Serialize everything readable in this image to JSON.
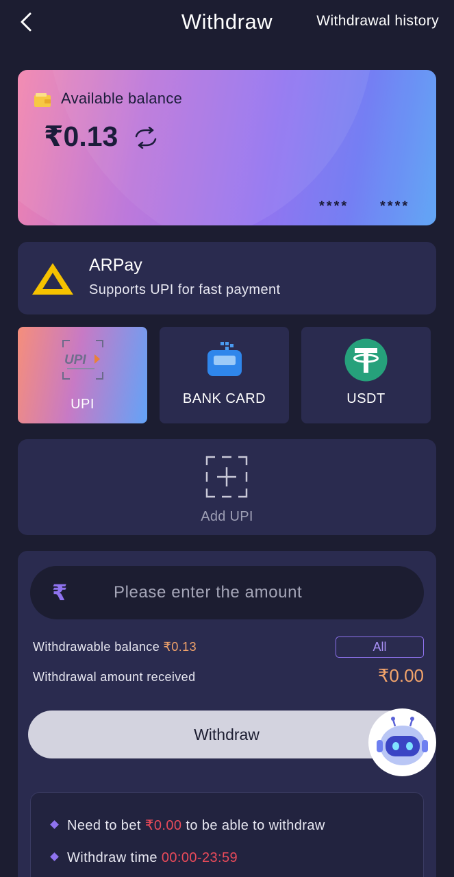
{
  "header": {
    "title": "Withdraw",
    "history_link": "Withdrawal history"
  },
  "balance_card": {
    "label": "Available balance",
    "value": "₹0.13",
    "masked_left": "****",
    "masked_right": "****"
  },
  "channel": {
    "name": "ARPay",
    "description": "Supports UPI for fast payment"
  },
  "methods": [
    {
      "label": "UPI",
      "icon": "upi-icon",
      "active": true
    },
    {
      "label": "BANK CARD",
      "icon": "bank-card-icon",
      "active": false
    },
    {
      "label": "USDT",
      "icon": "usdt-icon",
      "active": false
    }
  ],
  "add_upi": {
    "label": "Add UPI"
  },
  "form": {
    "currency_symbol": "₹",
    "amount_placeholder": "Please enter the amount",
    "withdrawable_label": "Withdrawable balance ",
    "withdrawable_value": "₹0.13",
    "all_button": "All",
    "received_label": "Withdrawal amount received",
    "received_value": "₹0.00",
    "withdraw_button": "Withdraw"
  },
  "notes": [
    {
      "before": "Need to bet ",
      "highlight": "₹0.00",
      "after": " to be able to withdraw"
    },
    {
      "before": "Withdraw time ",
      "highlight": "00:00-23:59",
      "after": ""
    }
  ],
  "colors": {
    "background": "#1c1d31",
    "panel": "#2a2b4f",
    "accent": "#8f73ef",
    "highlight_orange": "#f3a46b",
    "highlight_red": "#ea4a5a"
  }
}
